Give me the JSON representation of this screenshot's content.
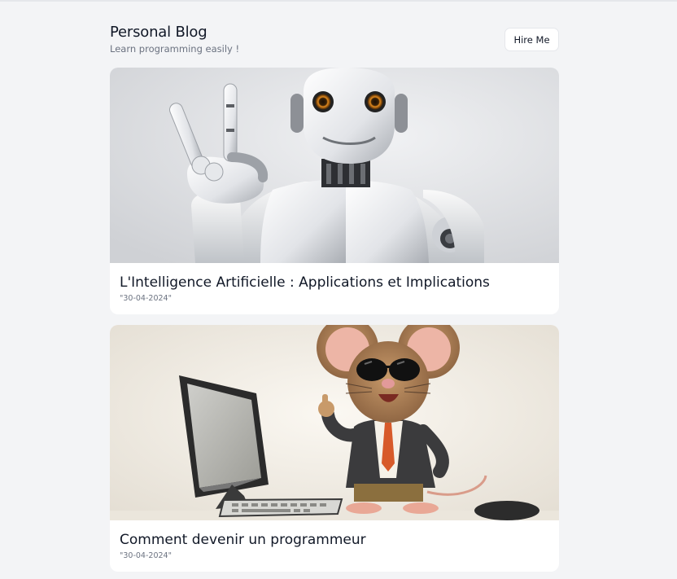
{
  "header": {
    "title": "Personal Blog",
    "subtitle": "Learn programming easily !",
    "hire_label": "Hire Me"
  },
  "posts": [
    {
      "title": "L'Intelligence Artificielle : Applications et Implications",
      "date": "\"30-04-2024\"",
      "image": "robot-illustration"
    },
    {
      "title": "Comment devenir un programmeur",
      "date": "\"30-04-2024\"",
      "image": "mouse-programmer-illustration"
    }
  ],
  "colors": {
    "background": "#f3f4f6",
    "card": "#ffffff",
    "text": "#111827",
    "muted": "#6b7280",
    "border": "#e5e7eb"
  }
}
